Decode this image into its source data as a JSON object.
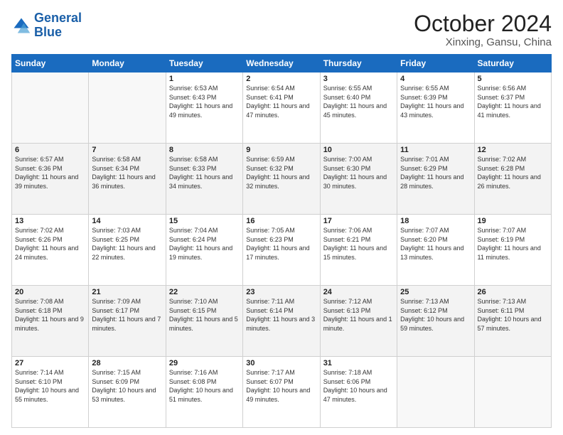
{
  "logo": {
    "line1": "General",
    "line2": "Blue"
  },
  "title": "October 2024",
  "subtitle": "Xinxing, Gansu, China",
  "weekdays": [
    "Sunday",
    "Monday",
    "Tuesday",
    "Wednesday",
    "Thursday",
    "Friday",
    "Saturday"
  ],
  "weeks": [
    [
      {
        "day": "",
        "info": ""
      },
      {
        "day": "",
        "info": ""
      },
      {
        "day": "1",
        "info": "Sunrise: 6:53 AM\nSunset: 6:43 PM\nDaylight: 11 hours and 49 minutes."
      },
      {
        "day": "2",
        "info": "Sunrise: 6:54 AM\nSunset: 6:41 PM\nDaylight: 11 hours and 47 minutes."
      },
      {
        "day": "3",
        "info": "Sunrise: 6:55 AM\nSunset: 6:40 PM\nDaylight: 11 hours and 45 minutes."
      },
      {
        "day": "4",
        "info": "Sunrise: 6:55 AM\nSunset: 6:39 PM\nDaylight: 11 hours and 43 minutes."
      },
      {
        "day": "5",
        "info": "Sunrise: 6:56 AM\nSunset: 6:37 PM\nDaylight: 11 hours and 41 minutes."
      }
    ],
    [
      {
        "day": "6",
        "info": "Sunrise: 6:57 AM\nSunset: 6:36 PM\nDaylight: 11 hours and 39 minutes."
      },
      {
        "day": "7",
        "info": "Sunrise: 6:58 AM\nSunset: 6:34 PM\nDaylight: 11 hours and 36 minutes."
      },
      {
        "day": "8",
        "info": "Sunrise: 6:58 AM\nSunset: 6:33 PM\nDaylight: 11 hours and 34 minutes."
      },
      {
        "day": "9",
        "info": "Sunrise: 6:59 AM\nSunset: 6:32 PM\nDaylight: 11 hours and 32 minutes."
      },
      {
        "day": "10",
        "info": "Sunrise: 7:00 AM\nSunset: 6:30 PM\nDaylight: 11 hours and 30 minutes."
      },
      {
        "day": "11",
        "info": "Sunrise: 7:01 AM\nSunset: 6:29 PM\nDaylight: 11 hours and 28 minutes."
      },
      {
        "day": "12",
        "info": "Sunrise: 7:02 AM\nSunset: 6:28 PM\nDaylight: 11 hours and 26 minutes."
      }
    ],
    [
      {
        "day": "13",
        "info": "Sunrise: 7:02 AM\nSunset: 6:26 PM\nDaylight: 11 hours and 24 minutes."
      },
      {
        "day": "14",
        "info": "Sunrise: 7:03 AM\nSunset: 6:25 PM\nDaylight: 11 hours and 22 minutes."
      },
      {
        "day": "15",
        "info": "Sunrise: 7:04 AM\nSunset: 6:24 PM\nDaylight: 11 hours and 19 minutes."
      },
      {
        "day": "16",
        "info": "Sunrise: 7:05 AM\nSunset: 6:23 PM\nDaylight: 11 hours and 17 minutes."
      },
      {
        "day": "17",
        "info": "Sunrise: 7:06 AM\nSunset: 6:21 PM\nDaylight: 11 hours and 15 minutes."
      },
      {
        "day": "18",
        "info": "Sunrise: 7:07 AM\nSunset: 6:20 PM\nDaylight: 11 hours and 13 minutes."
      },
      {
        "day": "19",
        "info": "Sunrise: 7:07 AM\nSunset: 6:19 PM\nDaylight: 11 hours and 11 minutes."
      }
    ],
    [
      {
        "day": "20",
        "info": "Sunrise: 7:08 AM\nSunset: 6:18 PM\nDaylight: 11 hours and 9 minutes."
      },
      {
        "day": "21",
        "info": "Sunrise: 7:09 AM\nSunset: 6:17 PM\nDaylight: 11 hours and 7 minutes."
      },
      {
        "day": "22",
        "info": "Sunrise: 7:10 AM\nSunset: 6:15 PM\nDaylight: 11 hours and 5 minutes."
      },
      {
        "day": "23",
        "info": "Sunrise: 7:11 AM\nSunset: 6:14 PM\nDaylight: 11 hours and 3 minutes."
      },
      {
        "day": "24",
        "info": "Sunrise: 7:12 AM\nSunset: 6:13 PM\nDaylight: 11 hours and 1 minute."
      },
      {
        "day": "25",
        "info": "Sunrise: 7:13 AM\nSunset: 6:12 PM\nDaylight: 10 hours and 59 minutes."
      },
      {
        "day": "26",
        "info": "Sunrise: 7:13 AM\nSunset: 6:11 PM\nDaylight: 10 hours and 57 minutes."
      }
    ],
    [
      {
        "day": "27",
        "info": "Sunrise: 7:14 AM\nSunset: 6:10 PM\nDaylight: 10 hours and 55 minutes."
      },
      {
        "day": "28",
        "info": "Sunrise: 7:15 AM\nSunset: 6:09 PM\nDaylight: 10 hours and 53 minutes."
      },
      {
        "day": "29",
        "info": "Sunrise: 7:16 AM\nSunset: 6:08 PM\nDaylight: 10 hours and 51 minutes."
      },
      {
        "day": "30",
        "info": "Sunrise: 7:17 AM\nSunset: 6:07 PM\nDaylight: 10 hours and 49 minutes."
      },
      {
        "day": "31",
        "info": "Sunrise: 7:18 AM\nSunset: 6:06 PM\nDaylight: 10 hours and 47 minutes."
      },
      {
        "day": "",
        "info": ""
      },
      {
        "day": "",
        "info": ""
      }
    ]
  ]
}
